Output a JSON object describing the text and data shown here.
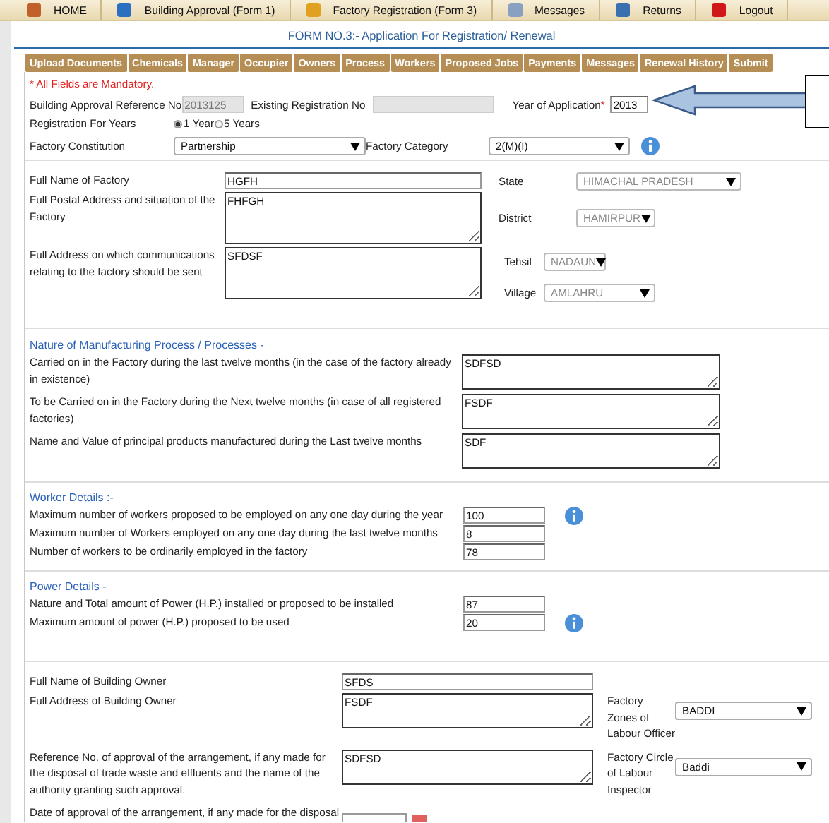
{
  "nav": [
    {
      "label": "HOME"
    },
    {
      "label": "Building Approval (Form 1)"
    },
    {
      "label": "Factory Registration (Form 3)"
    },
    {
      "label": "Messages"
    },
    {
      "label": "Returns"
    },
    {
      "label": "Logout"
    }
  ],
  "form_title": "FORM NO.3:- Application For Registration/ Renewal",
  "tabs": [
    "Upload Documents",
    "Chemicals",
    "Manager",
    "Occupier",
    "Owners",
    "Process",
    "Workers",
    "Proposed Jobs",
    "Payments",
    "Messages",
    "Renewal History",
    "Submit"
  ],
  "mandatory_note": "* All Fields are Mandatory.",
  "building_ref": {
    "label": "Building Approval Reference No",
    "value": "2013125",
    "disabled": true
  },
  "existing_reg": {
    "label": "Existing Registration No",
    "disabled": true
  },
  "year": {
    "label": "Year of Application",
    "required_mark": "*",
    "value": "2013"
  },
  "registration_years": {
    "label": "Registration For Years",
    "options": [
      {
        "label": "1 Year",
        "selected": true
      },
      {
        "label": "5 Years",
        "selected": false
      }
    ]
  },
  "constitution": {
    "label": "Factory Constitution",
    "value": "Partnership"
  },
  "category": {
    "label": "Factory Category",
    "value": "2(M)(I)"
  },
  "factory_fields": [
    {
      "label": "Full Name of Factory",
      "value": "HGFH",
      "kind": "input"
    },
    {
      "label": "Full Postal Address and situation of the Factory",
      "value": "FHFGH",
      "kind": "textarea"
    },
    {
      "label": "Full Address on which communications relating to the factory should be sent",
      "value": "SFDSF",
      "kind": "textarea"
    }
  ],
  "locations": [
    {
      "label": "State",
      "value": "HIMACHAL PRADESH",
      "disabled": true
    },
    {
      "label": "District",
      "value": "HAMIRPUR",
      "disabled": true
    },
    {
      "label": "Tehsil",
      "value": "NADAUN",
      "disabled": true
    },
    {
      "label": "Village",
      "value": "AMLAHRU",
      "disabled": true
    }
  ],
  "sections": [
    {
      "heading": "Nature of Manufacturing Process / Processes -",
      "fields": [
        {
          "label": "Carried on in the Factory during the last twelve months (in the case of the factory already in existence)",
          "value": "SDFSD",
          "kind": "textarea",
          "info": false
        },
        {
          "label": "To be Carried on in the Factory during the Next twelve months (in case of all registered factories)",
          "value": "FSDF",
          "kind": "textarea",
          "info": false
        },
        {
          "label": "Name and Value of principal products manufactured during the Last twelve months",
          "value": "SDF",
          "kind": "textarea",
          "info": false
        }
      ]
    },
    {
      "heading": "Worker Details :-",
      "fields": [
        {
          "label": "Maximum number of workers proposed to be employed on any one day during the year",
          "value": "100",
          "kind": "input",
          "info": true
        },
        {
          "label": "Maximum number of Workers employed on any one day during the last twelve months",
          "value": "8",
          "kind": "input",
          "info": false
        },
        {
          "label": "Number of workers to be ordinarily employed in the factory",
          "value": "78",
          "kind": "input",
          "info": false
        }
      ]
    },
    {
      "heading": "Power Details -",
      "fields": [
        {
          "label": "Nature and Total amount of Power (H.P.) installed or proposed to be installed",
          "value": "87",
          "kind": "input",
          "info": false
        },
        {
          "label": "Maximum amount of power (H.P.) proposed to be used",
          "value": "20",
          "kind": "input",
          "info": true
        }
      ]
    }
  ],
  "owner_fields": [
    {
      "label": "Full Name of Building Owner",
      "value": "SFDS",
      "kind": "input"
    },
    {
      "label": "Full Address of Building Owner",
      "value": "FSDF",
      "kind": "textarea",
      "side": {
        "label": "Factory Zones of Labour Officer",
        "value": "BADDI"
      }
    },
    {
      "label": "Reference No. of approval of the arrangement, if any made for the disposal of trade waste and effluents and the name of the authority granting such approval.",
      "value": "SDFSD",
      "kind": "textarea",
      "side": {
        "label": "Factory Circle of Labour Inspector",
        "value": "Baddi"
      }
    },
    {
      "label": "Date of approval of the arrangement, if any made for the disposal",
      "kind": "date"
    }
  ]
}
